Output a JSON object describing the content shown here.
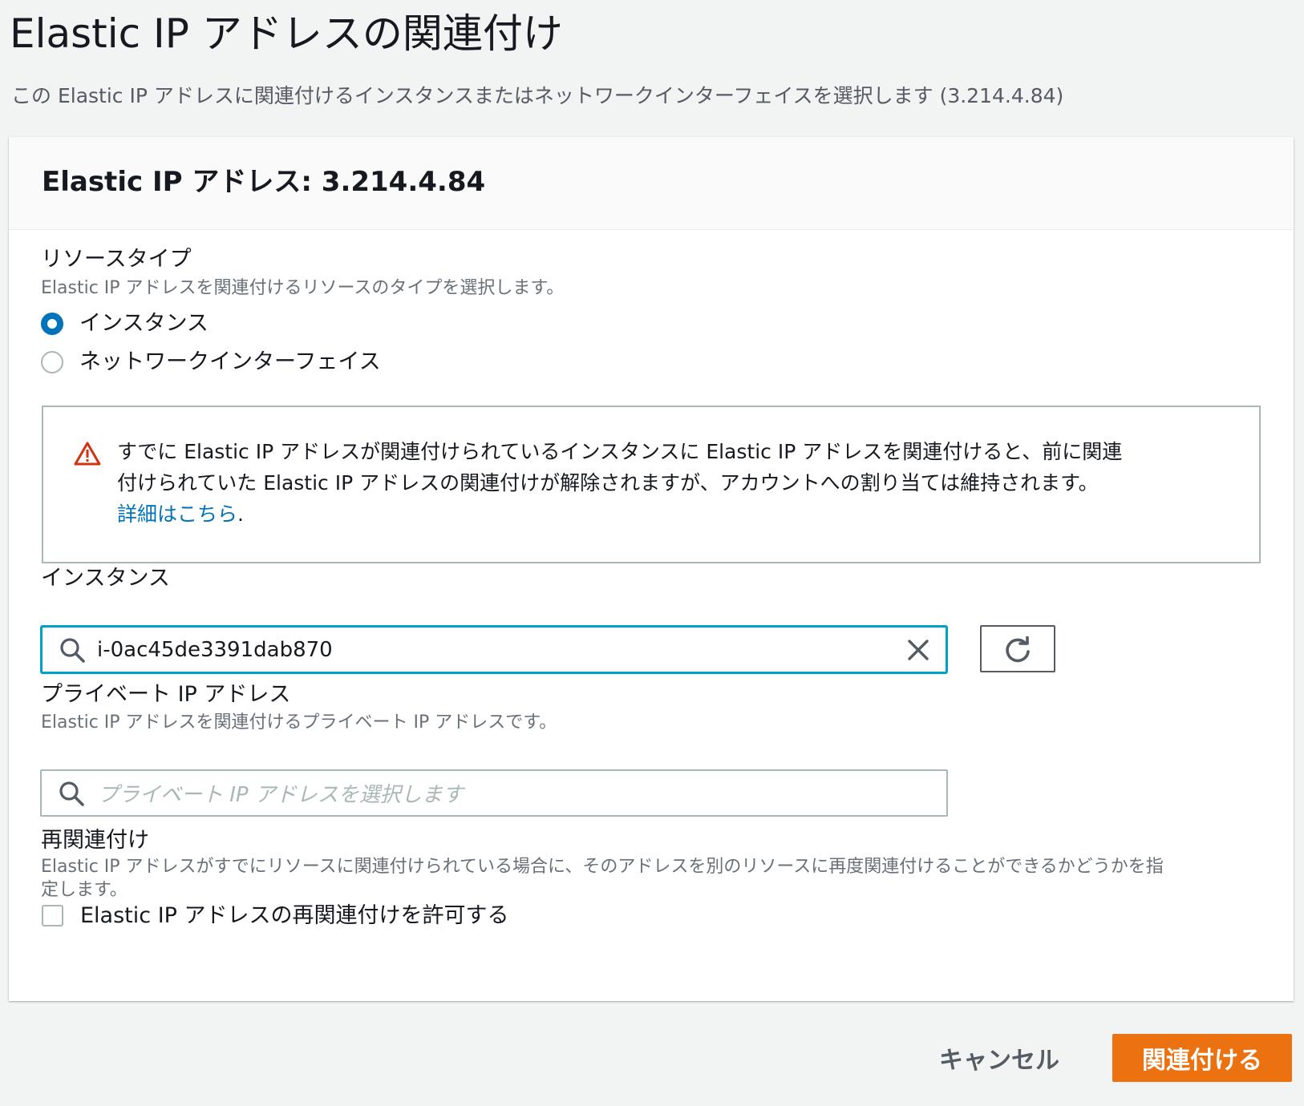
{
  "page": {
    "title": "Elastic IP アドレスの関連付け",
    "description": "この Elastic IP アドレスに関連付けるインスタンスまたはネットワークインターフェイスを選択します (3.214.4.84)"
  },
  "panel": {
    "title": "Elastic IP アドレス: 3.214.4.84",
    "resource_type": {
      "label": "リソースタイプ",
      "description": "Elastic IP アドレスを関連付けるリソースのタイプを選択します。",
      "options": [
        {
          "label": "インスタンス",
          "selected": true
        },
        {
          "label": "ネットワークインターフェイス",
          "selected": false
        }
      ]
    },
    "warning": {
      "line1": "すでに Elastic IP アドレスが関連付けられているインスタンスに Elastic IP アドレスを関連付けると、前に関連",
      "line2": "付けられていた Elastic IP アドレスの関連付けが解除されますが、アカウントへの割り当ては維持されます。",
      "link_text": "詳細はこちら",
      "link_suffix": "."
    },
    "instance": {
      "label": "インスタンス",
      "value": "i-0ac45de3391dab870"
    },
    "private_ip": {
      "label": "プライベート IP アドレス",
      "description": "Elastic IP アドレスを関連付けるプライベート IP アドレスです。",
      "placeholder": "プライベート IP アドレスを選択します"
    },
    "reassociation": {
      "label": "再関連付け",
      "description_line1": "Elastic IP アドレスがすでにリソースに関連付けられている場合に、そのアドレスを別のリソースに再度関連付けることができるかどうかを指",
      "description_line2": "定します。",
      "checkbox_label": "Elastic IP アドレスの再関連付けを許可する",
      "checked": false
    }
  },
  "actions": {
    "cancel_label": "キャンセル",
    "associate_label": "関連付ける"
  },
  "colors": {
    "accent": "#0073bb",
    "focus": "#00a1c9",
    "primary_button": "#ec7211",
    "warning": "#d13212"
  }
}
